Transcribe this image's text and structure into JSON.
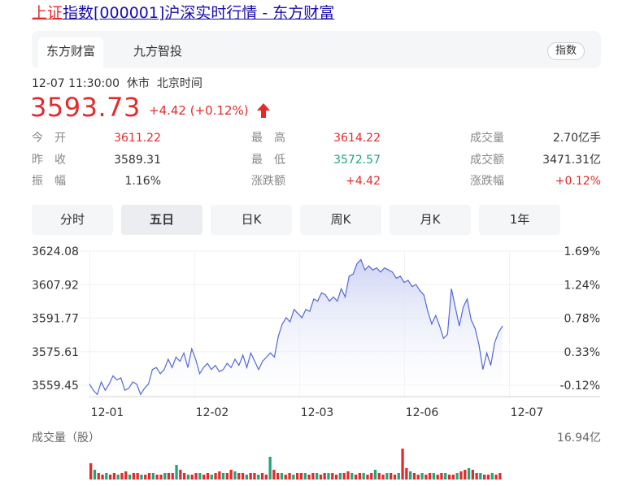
{
  "page_title": {
    "highlight": "上证",
    "rest": "指数[000001]沪深实时行情 - 东方财富"
  },
  "tabs": [
    {
      "label": "东方财富",
      "active": true
    },
    {
      "label": "九方智投",
      "active": false
    }
  ],
  "badge": "指数",
  "timestamp": "12-07 11:30:00",
  "market_status": "休市",
  "timezone": "北京时间",
  "price": "3593.73",
  "change": "+4.42 (+0.12%)",
  "stats": {
    "open_label": "今　开",
    "open": "3611.22",
    "high_label": "最　高",
    "high": "3614.22",
    "volume_label": "成交量",
    "volume": "2.70亿手",
    "prevclose_label": "昨　收",
    "prevclose": "3589.31",
    "low_label": "最　低",
    "low": "3572.57",
    "amount_label": "成交额",
    "amount": "3471.31亿",
    "amplitude_label": "振　幅",
    "amplitude": "1.16%",
    "chg_label": "涨跌额",
    "chg": "+4.42",
    "chgpct_label": "涨跌幅",
    "chgpct": "+0.12%"
  },
  "periods": [
    {
      "label": "分时",
      "active": false
    },
    {
      "label": "五日",
      "active": true
    },
    {
      "label": "日K",
      "active": false
    },
    {
      "label": "周K",
      "active": false
    },
    {
      "label": "月K",
      "active": false
    },
    {
      "label": "1年",
      "active": false
    }
  ],
  "colors": {
    "up": "#e42b2b",
    "down": "#1fa67a",
    "line": "#5468d6",
    "fill": "#dfe3f7"
  },
  "chart_data": {
    "type": "area",
    "x_ticks": [
      "12-01",
      "12-02",
      "12-03",
      "12-06",
      "12-07"
    ],
    "y_ticks": [
      "3624.08",
      "3607.92",
      "3591.77",
      "3575.61",
      "3559.45"
    ],
    "y_ticks_right": [
      "1.69%",
      "1.24%",
      "0.78%",
      "0.33%",
      "-0.12%"
    ],
    "ylim": [
      3559.45,
      3624.08
    ],
    "sessions": 5,
    "values": [
      3560,
      3557,
      3555,
      3561,
      3557,
      3560,
      3564,
      3562,
      3563,
      3557,
      3558,
      3561,
      3560,
      3555,
      3558,
      3560,
      3567,
      3568,
      3565,
      3567,
      3572,
      3568,
      3573,
      3571,
      3575,
      3568,
      3577,
      3572,
      3565,
      3568,
      3570,
      3567,
      3569,
      3566,
      3567,
      3570,
      3568,
      3572,
      3569,
      3574,
      3568,
      3575,
      3571,
      3567,
      3571,
      3573,
      3575,
      3573,
      3583,
      3589,
      3592,
      3590,
      3596,
      3594,
      3592,
      3596,
      3595,
      3601,
      3600,
      3604,
      3603,
      3600,
      3602,
      3600,
      3606,
      3602,
      3612,
      3613,
      3618,
      3620,
      3615,
      3617,
      3615,
      3616,
      3614,
      3616,
      3615,
      3614,
      3611,
      3612,
      3609,
      3610,
      3607,
      3608,
      3605,
      3603,
      3595,
      3589,
      3593,
      3588,
      3582,
      3584,
      3606,
      3597,
      3588,
      3597,
      3601,
      3591,
      3587,
      3579,
      3567,
      3575,
      3569,
      3580,
      3585,
      3588
    ]
  },
  "volume": {
    "label": "成交量（股）",
    "max_label": "16.94亿",
    "bars": [
      0.5,
      0.3,
      0.2,
      0.15,
      0.2,
      0.15,
      0.2,
      0.15,
      0.2,
      0.25,
      0.15,
      0.2,
      0.2,
      0.15,
      0.15,
      0.2,
      0.2,
      0.15,
      0.15,
      0.2,
      0.2,
      0.2,
      0.45,
      0.3,
      0.2,
      0.15,
      0.15,
      0.2,
      0.2,
      0.15,
      0.2,
      0.15,
      0.2,
      0.25,
      0.2,
      0.2,
      0.3,
      0.25,
      0.2,
      0.2,
      0.15,
      0.2,
      0.2,
      0.15,
      0.2,
      0.15,
      0.7,
      0.3,
      0.2,
      0.2,
      0.15,
      0.2,
      0.15,
      0.2,
      0.2,
      0.2,
      0.15,
      0.2,
      0.2,
      0.15,
      0.2,
      0.2,
      0.2,
      0.15,
      0.2,
      0.2,
      0.25,
      0.2,
      0.15,
      0.2,
      0.2,
      0.15,
      0.2,
      0.3,
      0.2,
      0.15,
      0.2,
      0.2,
      0.15,
      0.2,
      0.95,
      0.35,
      0.25,
      0.2,
      0.15,
      0.2,
      0.15,
      0.2,
      0.2,
      0.15,
      0.2,
      0.2,
      0.15,
      0.15,
      0.2,
      0.25,
      0.3,
      0.35,
      0.3,
      0.2,
      0.2,
      0.15,
      0.15,
      0.2,
      0.15,
      0.2
    ]
  }
}
